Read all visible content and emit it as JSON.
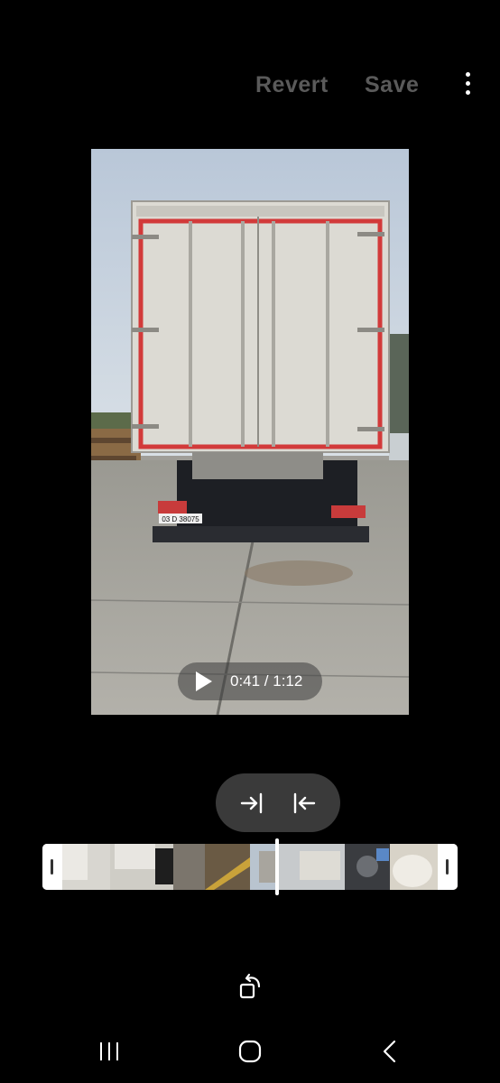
{
  "toolbar": {
    "revert_label": "Revert",
    "save_label": "Save",
    "more_icon": "more-vertical-icon"
  },
  "player": {
    "current_time": "0:41",
    "duration": "1:12",
    "time_display": "0:41 / 1:12",
    "play_icon": "play-icon",
    "progress": 0.569
  },
  "video_frame": {
    "license_plate": "03 D 38075"
  },
  "trim": {
    "start_icon": "trim-start-icon",
    "end_icon": "trim-end-icon"
  },
  "edit": {
    "rotate_icon": "rotate-icon"
  },
  "navbar": {
    "recents_icon": "recents-icon",
    "home_icon": "home-icon",
    "back_icon": "back-icon"
  },
  "colors": {
    "background": "#000000",
    "inactive_text": "#5a5a5a",
    "pill": "#3a3a3a"
  }
}
